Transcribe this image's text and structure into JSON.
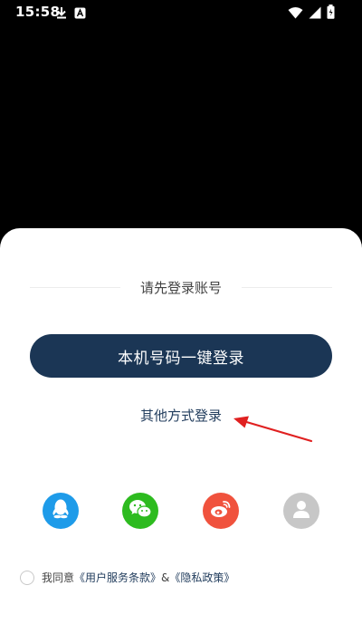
{
  "status_bar": {
    "time": "15:58",
    "left_icons": [
      "download-icon",
      "app-notification-icon"
    ],
    "right_icons": [
      "wifi-icon",
      "signal-icon",
      "battery-icon"
    ]
  },
  "login_sheet": {
    "title": "请先登录账号",
    "primary_button_label": "本机号码一键登录",
    "other_methods_label": "其他方式登录",
    "social_logins": [
      {
        "name": "qq",
        "icon": "qq-icon",
        "color": "#1e9be9"
      },
      {
        "name": "wechat",
        "icon": "wechat-icon",
        "color": "#2dbb1f"
      },
      {
        "name": "weibo",
        "icon": "weibo-icon",
        "color": "#f0523d"
      },
      {
        "name": "account",
        "icon": "user-icon",
        "color": "#c7c7c7"
      }
    ],
    "agreement": {
      "prefix": "我同意",
      "terms_label": "《用户服务条款》",
      "joiner": "&",
      "privacy_label": "《隐私政策》"
    }
  },
  "colors": {
    "primary_button": "#1b3655",
    "link_text": "#233e5e",
    "annotation_arrow": "#e02020"
  }
}
